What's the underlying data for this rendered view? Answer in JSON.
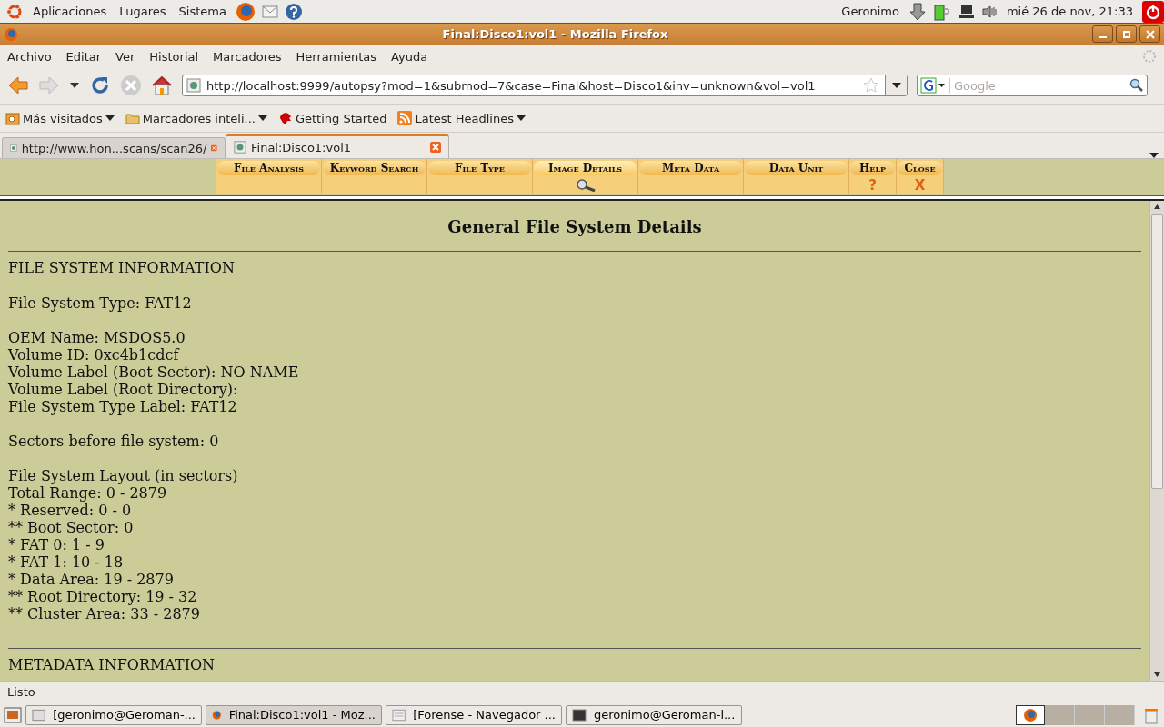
{
  "top_panel": {
    "menus": [
      "Aplicaciones",
      "Lugares",
      "Sistema"
    ],
    "user": "Geronimo",
    "clock": "mié 26 de nov, 21:33"
  },
  "window": {
    "title": "Final:Disco1:vol1 - Mozilla Firefox"
  },
  "menubar": [
    "Archivo",
    "Editar",
    "Ver",
    "Historial",
    "Marcadores",
    "Herramientas",
    "Ayuda"
  ],
  "navigation": {
    "url": "http://localhost:9999/autopsy?mod=1&submod=7&case=Final&host=Disco1&inv=unknown&vol=vol1",
    "search": {
      "placeholder": "Google"
    }
  },
  "bookmarks": [
    {
      "label": "Más visitados",
      "kind": "folder-menu"
    },
    {
      "label": "Marcadores inteli...",
      "kind": "feed-menu"
    },
    {
      "label": "Getting Started",
      "kind": "link"
    },
    {
      "label": "Latest Headlines",
      "kind": "rss-menu"
    }
  ],
  "tabs": [
    {
      "label": "http://www.hon...scans/scan26/",
      "selected": false
    },
    {
      "label": "Final:Disco1:vol1",
      "selected": true
    }
  ],
  "autopsy_toolbar": [
    {
      "label": "File Analysis",
      "selected": false,
      "kind": "module"
    },
    {
      "label": "Keyword Search",
      "selected": false,
      "kind": "module"
    },
    {
      "label": "File Type",
      "selected": false,
      "kind": "module"
    },
    {
      "label": "Image Details",
      "selected": true,
      "kind": "module"
    },
    {
      "label": "Meta Data",
      "selected": false,
      "kind": "module"
    },
    {
      "label": "Data Unit",
      "selected": false,
      "kind": "module"
    },
    {
      "label": "Help",
      "selected": false,
      "kind": "help",
      "symbol": "?"
    },
    {
      "label": "Close",
      "selected": false,
      "kind": "close",
      "symbol": "X"
    }
  ],
  "page": {
    "title": "General File System Details",
    "sections": [
      {
        "heading": "FILE SYSTEM INFORMATION",
        "paragraphs": [
          [
            "File System Type: FAT12"
          ],
          [
            "OEM Name: MSDOS5.0",
            "Volume ID: 0xc4b1cdcf",
            "Volume Label (Boot Sector): NO NAME",
            "Volume Label (Root Directory):",
            "File System Type Label: FAT12"
          ],
          [
            "Sectors before file system: 0"
          ],
          [
            "File System Layout (in sectors)",
            "Total Range: 0 - 2879",
            "* Reserved: 0 - 0",
            "** Boot Sector: 0",
            "* FAT 0: 1 - 9",
            "* FAT 1: 10 - 18",
            "* Data Area: 19 - 2879",
            "** Root Directory: 19 - 32",
            "** Cluster Area: 33 - 2879"
          ]
        ]
      },
      {
        "heading": "METADATA INFORMATION"
      }
    ]
  },
  "status_bar": "Listo",
  "taskbar": [
    {
      "label": "[geronimo@Geroman-...",
      "selected": false,
      "kind": "folder"
    },
    {
      "label": "Final:Disco1:vol1 - Moz...",
      "selected": true,
      "kind": "firefox"
    },
    {
      "label": "[Forense - Navegador ...",
      "selected": false,
      "kind": "browser"
    },
    {
      "label": "geronimo@Geroman-l...",
      "selected": false,
      "kind": "terminal"
    }
  ]
}
